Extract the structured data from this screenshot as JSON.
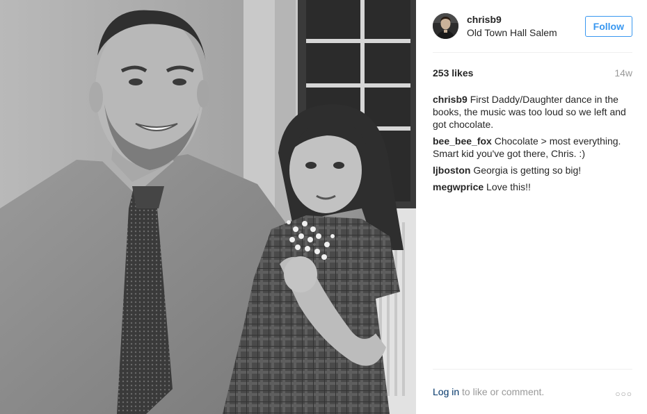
{
  "owner": {
    "username": "chrisb9",
    "location": "Old Town Hall Salem",
    "follow_label": "Follow"
  },
  "post": {
    "likes": "253 likes",
    "age": "14w"
  },
  "comments": [
    {
      "user": "chrisb9",
      "text": "First Daddy/Daughter dance in the books, the music was too loud so we left and got chocolate."
    },
    {
      "user": "bee_bee_fox",
      "text": "Chocolate > most everything. Smart kid you've got there, Chris. :)"
    },
    {
      "user": "ljboston",
      "text": "Georgia is getting so big!"
    },
    {
      "user": "megwprice",
      "text": "Love this!!"
    }
  ],
  "footer": {
    "login_link": "Log in",
    "login_rest": "to like or comment.",
    "more_icon": "more-options-icon"
  },
  "colors": {
    "accent": "#3897f0",
    "link": "#003569",
    "muted": "#999999",
    "text": "#262626"
  }
}
